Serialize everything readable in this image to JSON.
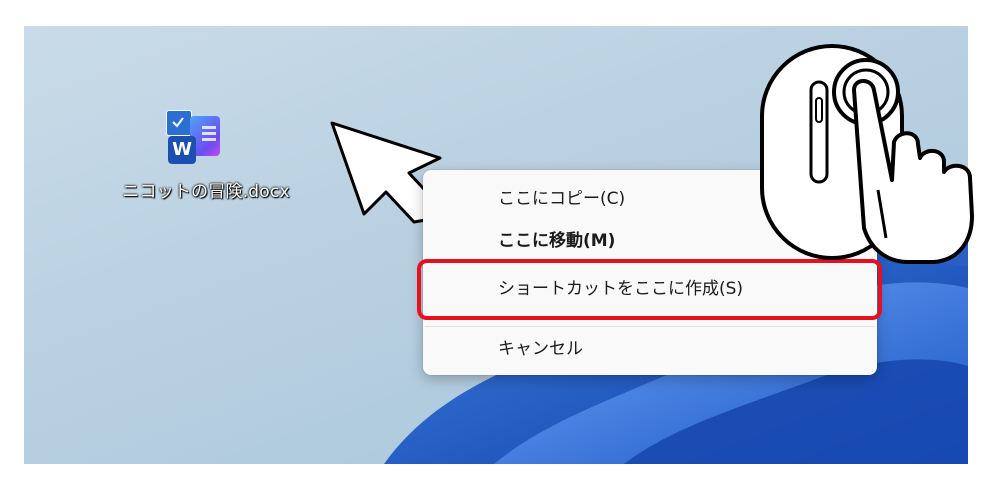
{
  "desktop": {
    "file": {
      "name": "ニコットの冒険.docx",
      "icon": "word-document-icon",
      "badge_letter": "W",
      "selected": true
    }
  },
  "context_menu": {
    "items": [
      {
        "label": "ここにコピー(C)",
        "bold": false
      },
      {
        "label": "ここに移動(M)",
        "bold": true
      },
      {
        "label": "ショートカットをここに作成(S)",
        "bold": false,
        "highlighted": true
      },
      {
        "label": "キャンセル",
        "bold": false
      }
    ]
  },
  "annotations": {
    "highlight_color": "#e8101e",
    "cursor_icon": "arrow-cursor-icon",
    "mouse_icon": "mouse-right-click-icon"
  }
}
